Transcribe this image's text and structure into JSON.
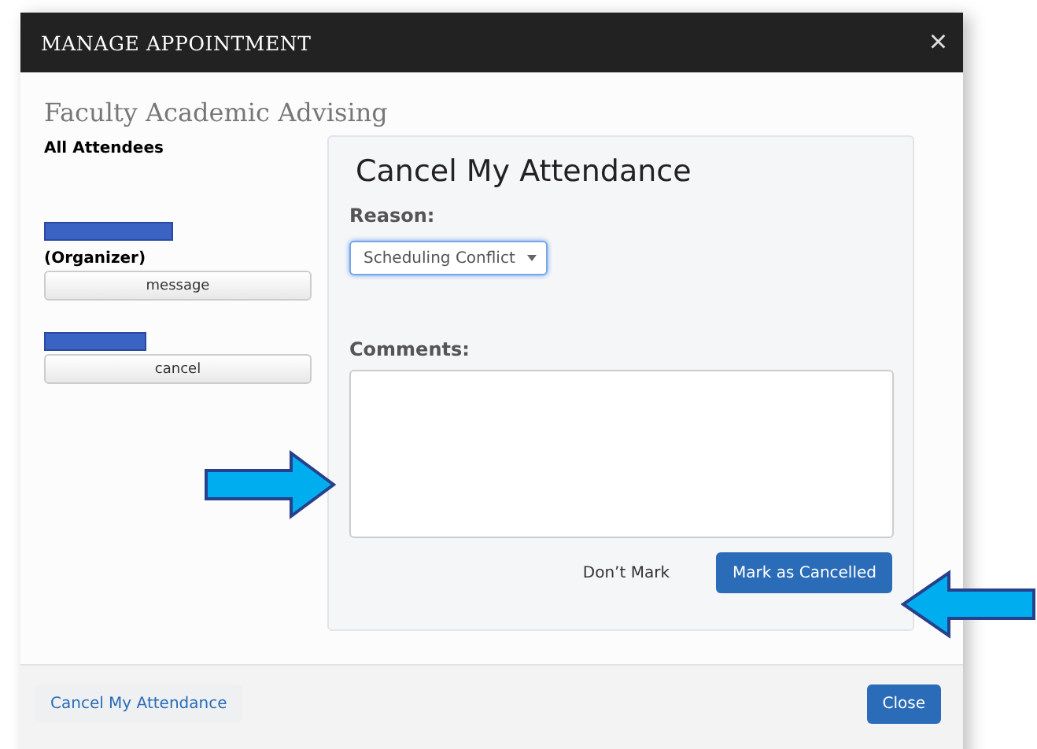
{
  "window": {
    "title": "MANAGE APPOINTMENT",
    "close": "×"
  },
  "heading": "Faculty Academic Advising",
  "attendees": {
    "title": "All Attendees",
    "items": [
      {
        "redacted": true,
        "role": "(Organizer)",
        "button": "message"
      },
      {
        "redacted": true,
        "button": "cancel"
      }
    ]
  },
  "cancel_panel": {
    "title": "Cancel My Attendance",
    "reason_label": "Reason:",
    "reason": {
      "value": "Scheduling Conflict",
      "focused": true
    },
    "comments_label": "Comments:",
    "buttons": [
      {
        "label": "Don’t Mark",
        "kind": "plain"
      },
      {
        "label": "Mark as Cancelled",
        "kind": "primary"
      }
    ]
  },
  "footer": {
    "buttons": [
      {
        "label": "Cancel My Attendance",
        "kind": "link"
      },
      {
        "label": "Close",
        "kind": "primary"
      }
    ]
  },
  "annotations": [
    {
      "kind": "arrow-right"
    },
    {
      "kind": "arrow-left"
    }
  ]
}
